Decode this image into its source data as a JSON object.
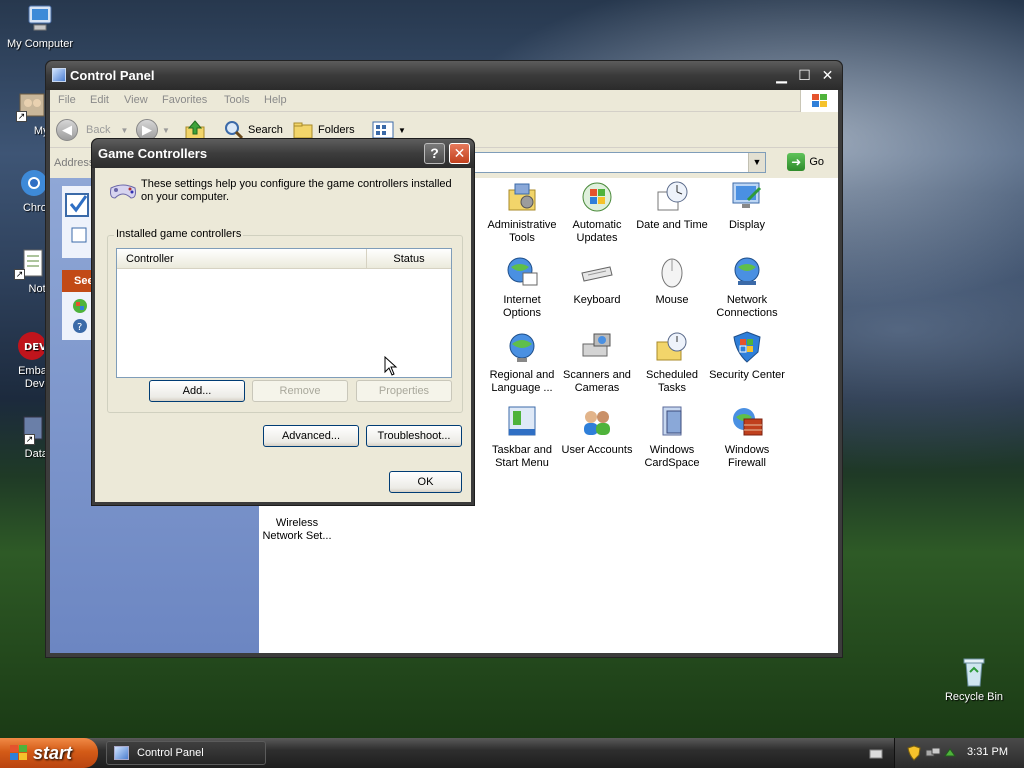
{
  "desktop": {
    "icons": [
      {
        "label": "My Computer"
      },
      {
        "label": "MyPa"
      },
      {
        "label": "Chrom"
      },
      {
        "label": "Notepa"
      },
      {
        "label": "Embarc\nDev-C"
      },
      {
        "label": "DataWa"
      },
      {
        "label": "Recycle Bin"
      }
    ]
  },
  "control_panel": {
    "title": "Control Panel",
    "menu": [
      "File",
      "Edit",
      "View",
      "Favorites",
      "Tools",
      "Help"
    ],
    "toolbar": {
      "back": "Back",
      "search": "Search",
      "folders": "Folders"
    },
    "address": {
      "label": "Address",
      "go": "Go"
    },
    "taskpane": {
      "section_head": "See"
    },
    "items": [
      {
        "label": "Administrative Tools",
        "icon": "administrative-tools-icon"
      },
      {
        "label": "Automatic Updates",
        "icon": "automatic-updates-icon"
      },
      {
        "label": "Date and Time",
        "icon": "date-time-icon"
      },
      {
        "label": "Display",
        "icon": "display-icon"
      },
      {
        "label": "Internet Options",
        "icon": "internet-options-icon"
      },
      {
        "label": "Keyboard",
        "icon": "keyboard-icon"
      },
      {
        "label": "Mouse",
        "icon": "mouse-icon"
      },
      {
        "label": "Network Connections",
        "icon": "network-connections-icon"
      },
      {
        "label": "Regional and Language ...",
        "icon": "regional-language-icon"
      },
      {
        "label": "Scanners and Cameras",
        "icon": "scanners-cameras-icon"
      },
      {
        "label": "Scheduled Tasks",
        "icon": "scheduled-tasks-icon"
      },
      {
        "label": "Security Center",
        "icon": "security-center-icon"
      },
      {
        "label": "Taskbar and Start Menu",
        "icon": "taskbar-start-menu-icon"
      },
      {
        "label": "User Accounts",
        "icon": "user-accounts-icon"
      },
      {
        "label": "Windows CardSpace",
        "icon": "windows-cardspace-icon"
      },
      {
        "label": "Windows Firewall",
        "icon": "windows-firewall-icon"
      },
      {
        "label": "Wireless Network Set...",
        "icon": "wireless-network-icon"
      }
    ]
  },
  "dialog": {
    "title": "Game Controllers",
    "intro": "These settings help you configure the game controllers installed on your computer.",
    "group_label": "Installed game controllers",
    "columns": {
      "controller": "Controller",
      "status": "Status"
    },
    "buttons": {
      "add": "Add...",
      "remove": "Remove",
      "properties": "Properties",
      "advanced": "Advanced...",
      "troubleshoot": "Troubleshoot...",
      "ok": "OK"
    }
  },
  "taskbar": {
    "start": "start",
    "task": "Control Panel",
    "clock": "3:31 PM"
  },
  "colors": {
    "title_bar": "#3a3a3a",
    "dialog_face": "#ece9d8",
    "task_pane": "#7b94cc",
    "start_button": "#d45b17"
  }
}
